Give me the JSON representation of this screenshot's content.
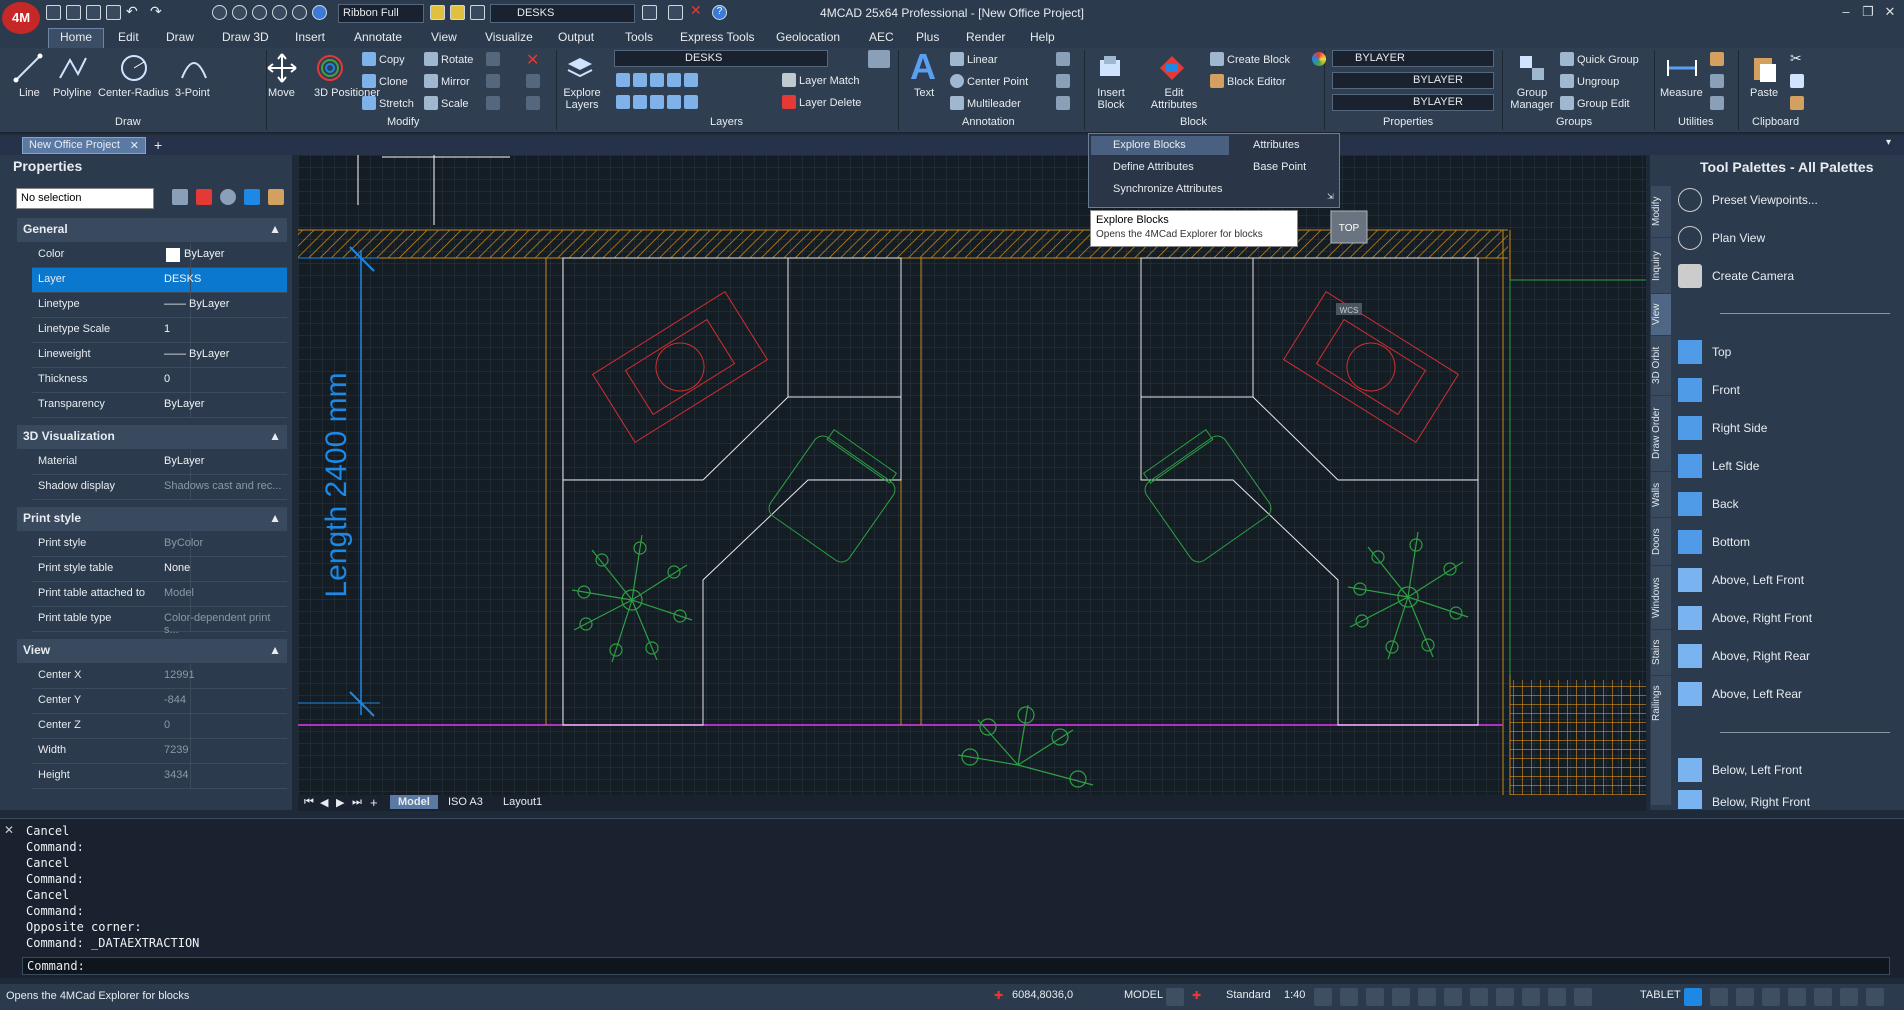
{
  "app": {
    "title": "4MCAD 25x64 Professional - [New Office Project]",
    "logo_text": "4M",
    "quick_access": {
      "style_value": "Ribbon Full",
      "layer_value": "DESKS"
    },
    "window_controls": [
      "–",
      "❐",
      "✕"
    ]
  },
  "menu": [
    "Home",
    "Edit",
    "Draw",
    "Draw 3D",
    "Insert",
    "Annotate",
    "View",
    "Visualize",
    "Output",
    "Tools",
    "Express Tools",
    "Geolocation",
    "AEC",
    "Plus",
    "Render",
    "Help"
  ],
  "ribbon": {
    "draw": {
      "label": "Draw",
      "tools": [
        "Line",
        "Polyline",
        "Center-Radius",
        "3-Point"
      ]
    },
    "modify": {
      "label": "Modify",
      "move": "Move",
      "positioner": "3D Positioner",
      "tools": [
        "Copy",
        "Rotate",
        "Clone",
        "Mirror",
        "Stretch",
        "Scale"
      ]
    },
    "layers": {
      "label": "Layers",
      "explore": "Explore Layers",
      "current_layer": "DESKS",
      "layer_match": "Layer Match",
      "layer_delete": "Layer Delete"
    },
    "annotation": {
      "label": "Annotation",
      "text": "Text",
      "tools": [
        "Linear",
        "Center Point",
        "Multileader"
      ]
    },
    "block": {
      "label": "Block",
      "insert": "Insert Block",
      "edit_attr": "Edit Attributes",
      "create": "Create Block",
      "editor": "Block Editor"
    },
    "properties": {
      "label": "Properties",
      "color": "BYLAYER",
      "linetype": "BYLAYER",
      "lineweight": "BYLAYER"
    },
    "groups": {
      "label": "Groups",
      "manager": "Group Manager",
      "tools": [
        "Quick Group",
        "Ungroup",
        "Group Edit"
      ]
    },
    "utilities": {
      "label": "Utilities",
      "measure": "Measure"
    },
    "clipboard": {
      "label": "Clipboard",
      "paste": "Paste"
    }
  },
  "doc_tab": "New Office Project",
  "properties_panel": {
    "title": "Properties",
    "selection": "No selection",
    "sections": [
      {
        "name": "General",
        "rows": [
          {
            "k": "Color",
            "v": "ByLayer"
          },
          {
            "k": "Layer",
            "v": "DESKS"
          },
          {
            "k": "Linetype",
            "v": "—— ByLayer"
          },
          {
            "k": "Linetype Scale",
            "v": "1"
          },
          {
            "k": "Lineweight",
            "v": "—— ByLayer"
          },
          {
            "k": "Thickness",
            "v": "0"
          },
          {
            "k": "Transparency",
            "v": "ByLayer"
          }
        ]
      },
      {
        "name": "3D Visualization",
        "rows": [
          {
            "k": "Material",
            "v": "ByLayer"
          },
          {
            "k": "Shadow display",
            "v": "Shadows cast and rec..."
          }
        ]
      },
      {
        "name": "Print style",
        "rows": [
          {
            "k": "Print style",
            "v": "ByColor"
          },
          {
            "k": "Print style table",
            "v": "None"
          },
          {
            "k": "Print table attached to",
            "v": "Model"
          },
          {
            "k": "Print table type",
            "v": "Color-dependent print s..."
          }
        ]
      },
      {
        "name": "View",
        "rows": [
          {
            "k": "Center X",
            "v": "12991"
          },
          {
            "k": "Center Y",
            "v": "-844"
          },
          {
            "k": "Center Z",
            "v": "0"
          },
          {
            "k": "Width",
            "v": "7239"
          },
          {
            "k": "Height",
            "v": "3434"
          }
        ]
      }
    ]
  },
  "block_flyout": {
    "items": [
      "Explore Blocks",
      "Attributes",
      "Define Attributes",
      "Base Point",
      "Synchronize Attributes"
    ],
    "tooltip_title": "Explore Blocks",
    "tooltip_desc": "Opens the 4MCad Explorer for blocks"
  },
  "canvas": {
    "dimension_text": "Length 2400 mm",
    "viewcube": "TOP",
    "wcs": "WCS"
  },
  "layout_tabs": [
    "Model",
    "ISO A3",
    "Layout1"
  ],
  "tool_palette": {
    "title": "Tool Palettes - All Palettes",
    "tabs": [
      "Modify",
      "Inquiry",
      "View",
      "3D Orbit",
      "Draw Order",
      "Walls",
      "Doors",
      "Windows",
      "Stairs",
      "Railings"
    ],
    "items": [
      "Preset Viewpoints...",
      "Plan View",
      "Create Camera",
      "Top",
      "Front",
      "Right Side",
      "Left Side",
      "Back",
      "Bottom",
      "Above, Left Front",
      "Above, Right Front",
      "Above, Right Rear",
      "Above, Left Rear",
      "Below, Left Front",
      "Below, Right Front"
    ]
  },
  "command": {
    "lines": [
      "Cancel",
      "Command:",
      "Cancel",
      "Command:",
      "Cancel",
      "Command:",
      "Opposite corner:",
      "Command: _DATAEXTRACTION"
    ],
    "prompt": "Command:"
  },
  "status": {
    "message": "Opens the 4MCad Explorer for blocks",
    "coords": "6084,8036,0",
    "space": "MODEL",
    "style": "Standard",
    "scale": "1:40",
    "tablet": "TABLET"
  }
}
